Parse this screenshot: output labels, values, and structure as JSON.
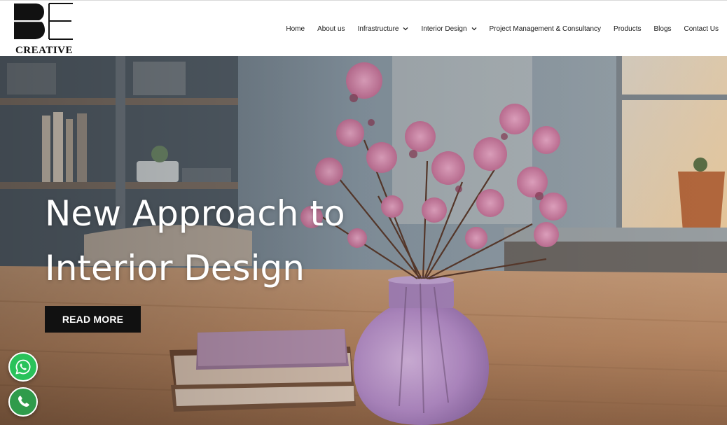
{
  "brand": {
    "name": "CREATIVE",
    "logo_icon": "be-monogram-logo"
  },
  "nav": {
    "items": [
      {
        "label": "Home",
        "has_dropdown": false
      },
      {
        "label": "About us",
        "has_dropdown": false
      },
      {
        "label": "Infrastructure",
        "has_dropdown": true
      },
      {
        "label": "Interior Design",
        "has_dropdown": true
      },
      {
        "label": "Project Management & Consultancy",
        "has_dropdown": false
      },
      {
        "label": "Products",
        "has_dropdown": false
      },
      {
        "label": "Blogs",
        "has_dropdown": false
      },
      {
        "label": "Contact Us",
        "has_dropdown": false
      }
    ],
    "dropdown_icon": "chevron-down-icon"
  },
  "hero": {
    "headline_line1": "New Approach to",
    "headline_line2": "Interior Design",
    "cta_label": "READ MORE",
    "background": "interior-room-with-flower-vase"
  },
  "floating": {
    "whatsapp_icon": "whatsapp-icon",
    "phone_icon": "phone-icon"
  },
  "colors": {
    "cta_background": "#111111",
    "whatsapp_green": "#29c25a",
    "header_background": "#ffffff"
  }
}
